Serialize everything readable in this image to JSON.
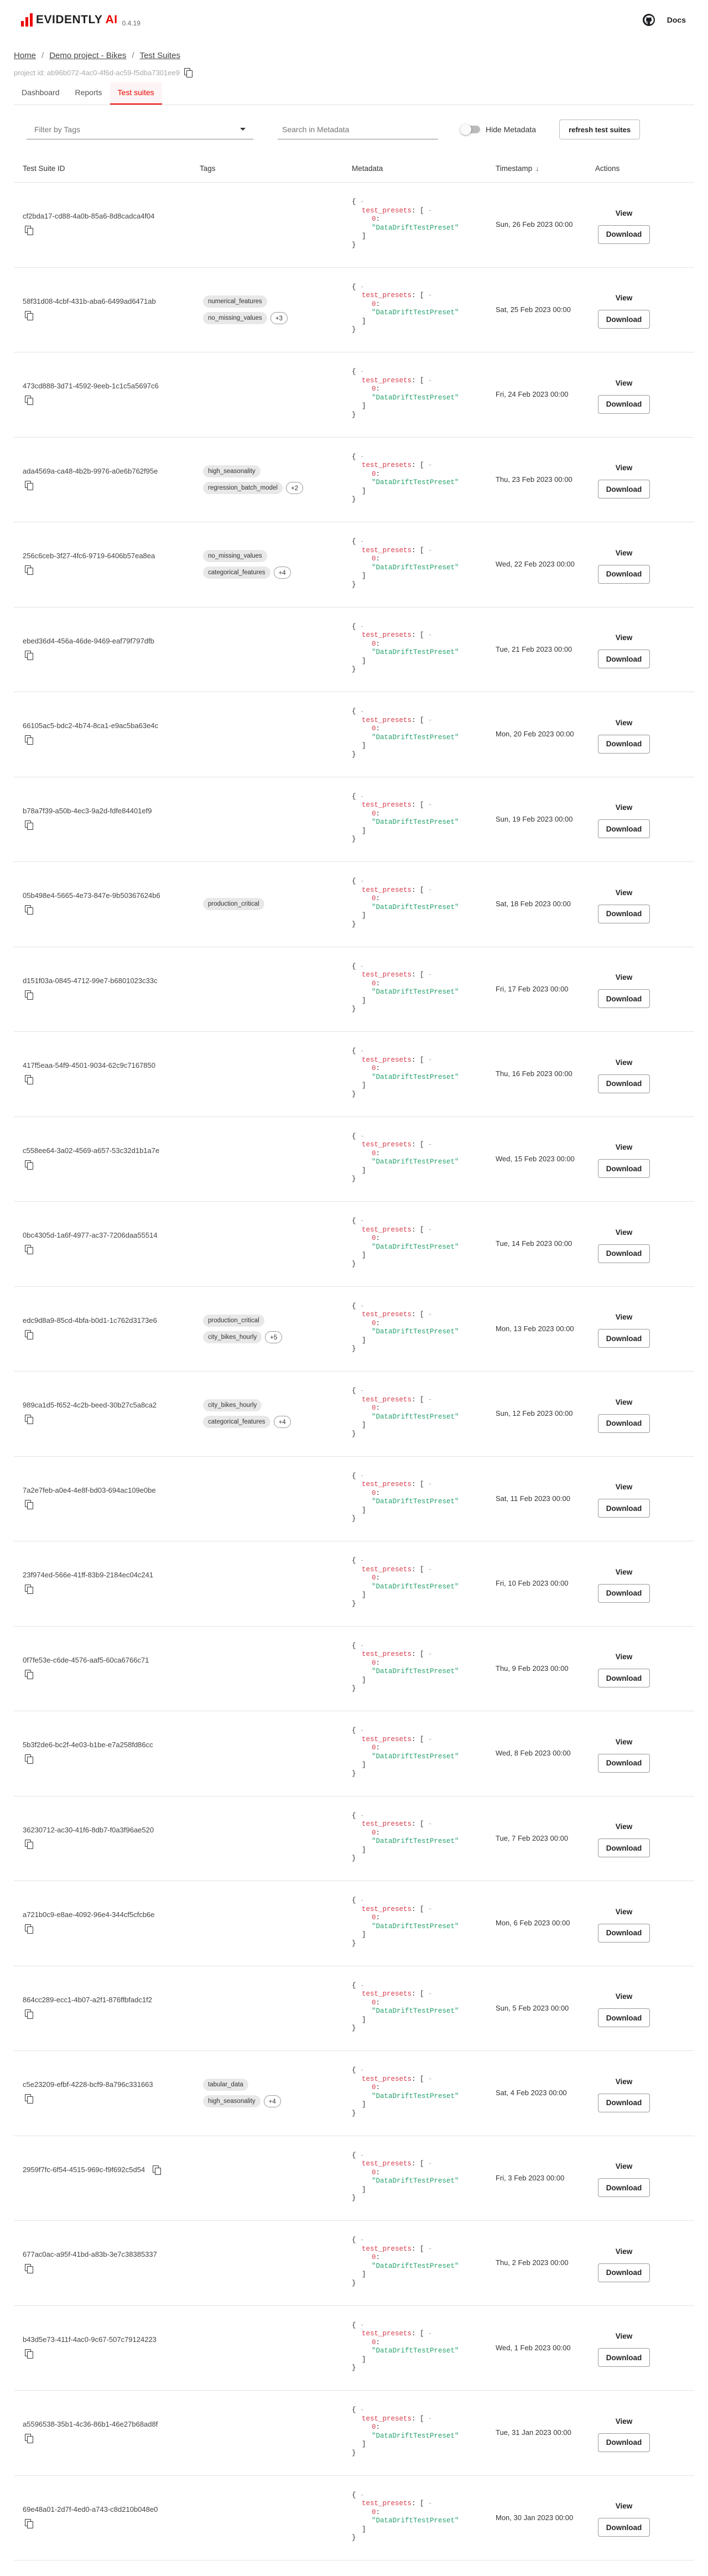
{
  "header": {
    "brand_main": "EVIDENTLY",
    "brand_accent": "AI",
    "version": "0.4.19",
    "docs_label": "Docs",
    "github_icon": "github-icon"
  },
  "breadcrumbs": {
    "home": "Home",
    "project": "Demo project - Bikes",
    "current": "Test Suites"
  },
  "project_id": "project id: ab96b072-4ac0-4f6d-ac59-f5dba7301ee9",
  "tabs": [
    {
      "label": "Dashboard",
      "active": false
    },
    {
      "label": "Reports",
      "active": false
    },
    {
      "label": "Test suites",
      "active": true
    }
  ],
  "controls": {
    "filter_placeholder": "Filter by Tags",
    "search_placeholder": "Search in Metadata",
    "hide_metadata_label": "Hide Metadata",
    "refresh_label": "refresh test suites"
  },
  "table": {
    "headers": {
      "id": "Test Suite ID",
      "tags": "Tags",
      "metadata": "Metadata",
      "timestamp": "Timestamp",
      "actions": "Actions"
    },
    "view_label": "View",
    "download_label": "Download",
    "metadata": {
      "key": "test_presets",
      "index": "0",
      "value": "\"DataDriftTestPreset\""
    },
    "rows": [
      {
        "id": "cf2bda17-cd88-4a0b-85a6-8d8cadca4f04",
        "tags": [],
        "more": "",
        "ts": "Sun, 26 Feb 2023 00:00"
      },
      {
        "id": "58f31d08-4cbf-431b-aba6-6499ad6471ab",
        "tags": [
          "numerical_features",
          "no_missing_values"
        ],
        "more": "+3",
        "ts": "Sat, 25 Feb 2023 00:00"
      },
      {
        "id": "473cd888-3d71-4592-9eeb-1c1c5a5697c6",
        "tags": [],
        "more": "",
        "ts": "Fri, 24 Feb 2023 00:00"
      },
      {
        "id": "ada4569a-ca48-4b2b-9976-a0e6b762f95e",
        "tags": [
          "high_seasonality",
          "regression_batch_model"
        ],
        "more": "+2",
        "ts": "Thu, 23 Feb 2023 00:00"
      },
      {
        "id": "256c6ceb-3f27-4fc6-9719-6406b57ea8ea",
        "tags": [
          "no_missing_values",
          "categorical_features"
        ],
        "more": "+4",
        "ts": "Wed, 22 Feb 2023 00:00"
      },
      {
        "id": "ebed36d4-456a-46de-9469-eaf79f797dfb",
        "tags": [],
        "more": "",
        "ts": "Tue, 21 Feb 2023 00:00"
      },
      {
        "id": "66105ac5-bdc2-4b74-8ca1-e9ac5ba63e4c",
        "tags": [],
        "more": "",
        "ts": "Mon, 20 Feb 2023 00:00"
      },
      {
        "id": "b78a7f39-a50b-4ec3-9a2d-fdfe84401ef9",
        "tags": [],
        "more": "",
        "ts": "Sun, 19 Feb 2023 00:00"
      },
      {
        "id": "05b498e4-5665-4e73-847e-9b50367624b6",
        "tags": [
          "production_critical"
        ],
        "more": "",
        "ts": "Sat, 18 Feb 2023 00:00"
      },
      {
        "id": "d151f03a-0845-4712-99e7-b6801023c33c",
        "tags": [],
        "more": "",
        "ts": "Fri, 17 Feb 2023 00:00"
      },
      {
        "id": "417f5eaa-54f9-4501-9034-62c9c7167850",
        "tags": [],
        "more": "",
        "ts": "Thu, 16 Feb 2023 00:00"
      },
      {
        "id": "c558ee64-3a02-4569-a657-53c32d1b1a7e",
        "tags": [],
        "more": "",
        "ts": "Wed, 15 Feb 2023 00:00"
      },
      {
        "id": "0bc4305d-1a6f-4977-ac37-7206daa55514",
        "tags": [],
        "more": "",
        "ts": "Tue, 14 Feb 2023 00:00"
      },
      {
        "id": "edc9d8a9-85cd-4bfa-b0d1-1c762d3173e6",
        "tags": [
          "production_critical",
          "city_bikes_hourly"
        ],
        "more": "+5",
        "ts": "Mon, 13 Feb 2023 00:00"
      },
      {
        "id": "989ca1d5-f652-4c2b-beed-30b27c5a8ca2",
        "tags": [
          "city_bikes_hourly",
          "categorical_features"
        ],
        "more": "+4",
        "ts": "Sun, 12 Feb 2023 00:00"
      },
      {
        "id": "7a2e7feb-a0e4-4e8f-bd03-694ac109e0be",
        "tags": [],
        "more": "",
        "ts": "Sat, 11 Feb 2023 00:00"
      },
      {
        "id": "23f974ed-566e-41ff-83b9-2184ec04c241",
        "tags": [],
        "more": "",
        "ts": "Fri, 10 Feb 2023 00:00"
      },
      {
        "id": "0f7fe53e-c6de-4576-aaf5-60ca6766c71",
        "tags": [],
        "more": "",
        "ts": "Thu, 9 Feb 2023 00:00"
      },
      {
        "id": "5b3f2de6-bc2f-4e03-b1be-e7a258fd86cc",
        "tags": [],
        "more": "",
        "ts": "Wed, 8 Feb 2023 00:00"
      },
      {
        "id": "36230712-ac30-41f6-8db7-f0a3f96ae520",
        "tags": [],
        "more": "",
        "ts": "Tue, 7 Feb 2023 00:00"
      },
      {
        "id": "a721b0c9-e8ae-4092-96e4-344cf5cfcb6e",
        "tags": [],
        "more": "",
        "ts": "Mon, 6 Feb 2023 00:00"
      },
      {
        "id": "864cc289-ecc1-4b07-a2f1-876ffbfadc1f2",
        "tags": [],
        "more": "",
        "ts": "Sun, 5 Feb 2023 00:00"
      },
      {
        "id": "c5e23209-efbf-4228-bcf9-8a796c331663",
        "tags": [
          "tabular_data",
          "high_seasonality"
        ],
        "more": "+4",
        "ts": "Sat, 4 Feb 2023 00:00"
      },
      {
        "id": "2959f7fc-6f54-4515-969c-f9f692c5d54",
        "tags": [],
        "more": "",
        "ts": "Fri, 3 Feb 2023 00:00"
      },
      {
        "id": "677ac0ac-a95f-41bd-a83b-3e7c38385337",
        "tags": [],
        "more": "",
        "ts": "Thu, 2 Feb 2023 00:00"
      },
      {
        "id": "b43d5e73-411f-4ac0-9c67-507c79124223",
        "tags": [],
        "more": "",
        "ts": "Wed, 1 Feb 2023 00:00"
      },
      {
        "id": "a5596538-35b1-4c36-86b1-46e27b68ad8f",
        "tags": [],
        "more": "",
        "ts": "Tue, 31 Jan 2023 00:00"
      },
      {
        "id": "69e48a01-2d7f-4ed0-a743-c8d210b048e0",
        "tags": [],
        "more": "",
        "ts": "Mon, 30 Jan 2023 00:00"
      }
    ]
  }
}
